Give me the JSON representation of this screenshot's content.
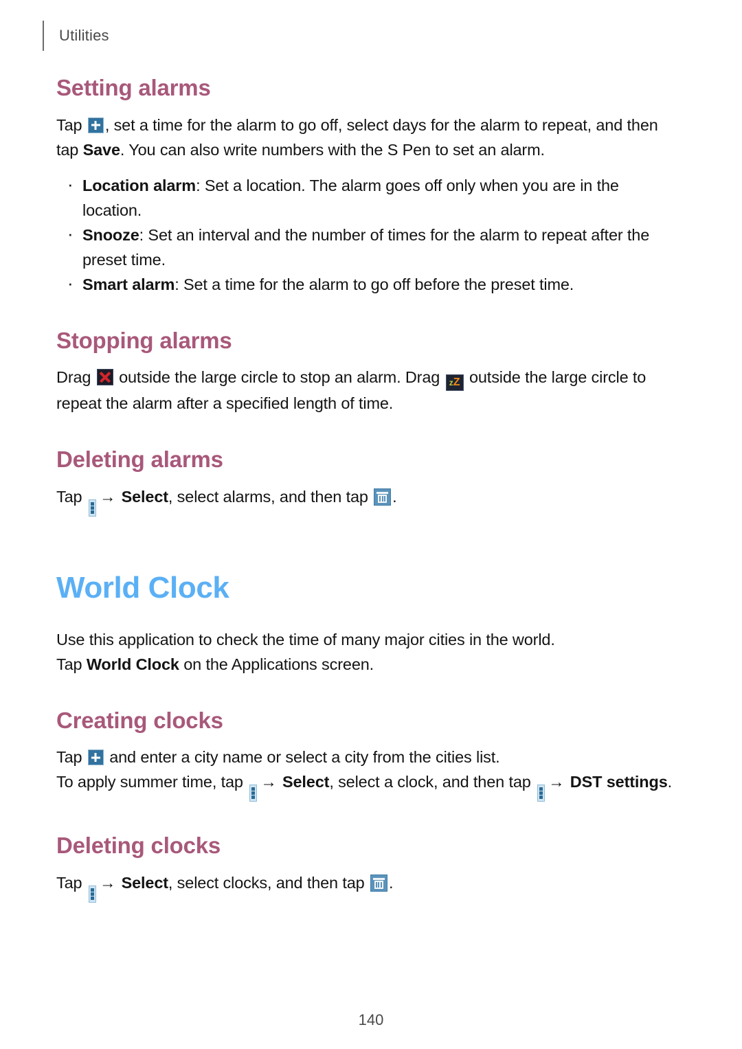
{
  "header": {
    "title": "Utilities"
  },
  "sections": [
    {
      "id": "setting-alarms",
      "heading": "Setting alarms",
      "paragraph_1_pre": "Tap ",
      "paragraph_1_mid": ", set a time for the alarm to go off, select days for the alarm to repeat, and then tap ",
      "paragraph_1_bold": "Save",
      "paragraph_1_post": ". You can also write numbers with the S Pen to set an alarm.",
      "bullets": [
        {
          "term": "Location alarm",
          "text": ": Set a location. The alarm goes off only when you are in the location."
        },
        {
          "term": "Snooze",
          "text": ": Set an interval and the number of times for the alarm to repeat after the preset time."
        },
        {
          "term": "Smart alarm",
          "text": ": Set a time for the alarm to go off before the preset time."
        }
      ]
    },
    {
      "id": "stopping-alarms",
      "heading": "Stopping alarms",
      "paragraph_pre": "Drag ",
      "paragraph_mid": " outside the large circle to stop an alarm. Drag ",
      "paragraph_post": " outside the large circle to repeat the alarm after a specified length of time."
    },
    {
      "id": "deleting-alarms",
      "heading": "Deleting alarms",
      "paragraph_pre": "Tap ",
      "paragraph_arrow": "→",
      "paragraph_bold": "Select",
      "paragraph_mid": ", select alarms, and then tap ",
      "paragraph_post": "."
    }
  ],
  "world_clock": {
    "heading": "World Clock",
    "intro_line_1": "Use this application to check the time of many major cities in the world.",
    "intro_line_2_pre": "Tap ",
    "intro_line_2_bold": "World Clock",
    "intro_line_2_post": " on the Applications screen.",
    "creating": {
      "heading": "Creating clocks",
      "line_1_pre": "Tap ",
      "line_1_post": " and enter a city name or select a city from the cities list.",
      "line_2_pre": "To apply summer time, tap ",
      "line_2_arrow_1": "→",
      "line_2_bold_1": "Select",
      "line_2_mid": ", select a clock, and then tap ",
      "line_2_arrow_2": "→",
      "line_2_bold_2": "DST settings",
      "line_2_post": "."
    },
    "deleting": {
      "heading": "Deleting clocks",
      "line_pre": "Tap ",
      "line_arrow": "→",
      "line_bold": "Select",
      "line_mid": ", select clocks, and then tap ",
      "line_post": "."
    }
  },
  "icons": {
    "plus": "plus-icon",
    "stop": "stop-alarm-icon",
    "snooze": "snooze-icon",
    "menu": "more-options-icon",
    "trash": "delete-icon",
    "snooze_z_lower": "z",
    "snooze_z_upper": "Z"
  },
  "footer": {
    "page_number": "140"
  },
  "colors": {
    "section_heading": "#a8587a",
    "app_heading": "#5bb0f5",
    "body_text": "#141414",
    "header_text": "#4a4a4a",
    "plus_icon_bg": "#31729f",
    "stop_icon_x": "#d4252b",
    "snooze_icon_z1": "#c3cf3a",
    "snooze_icon_z2": "#ef8a14",
    "menu_icon_bg": "#cfe4f2",
    "trash_icon_bg": "#5b93bb"
  }
}
